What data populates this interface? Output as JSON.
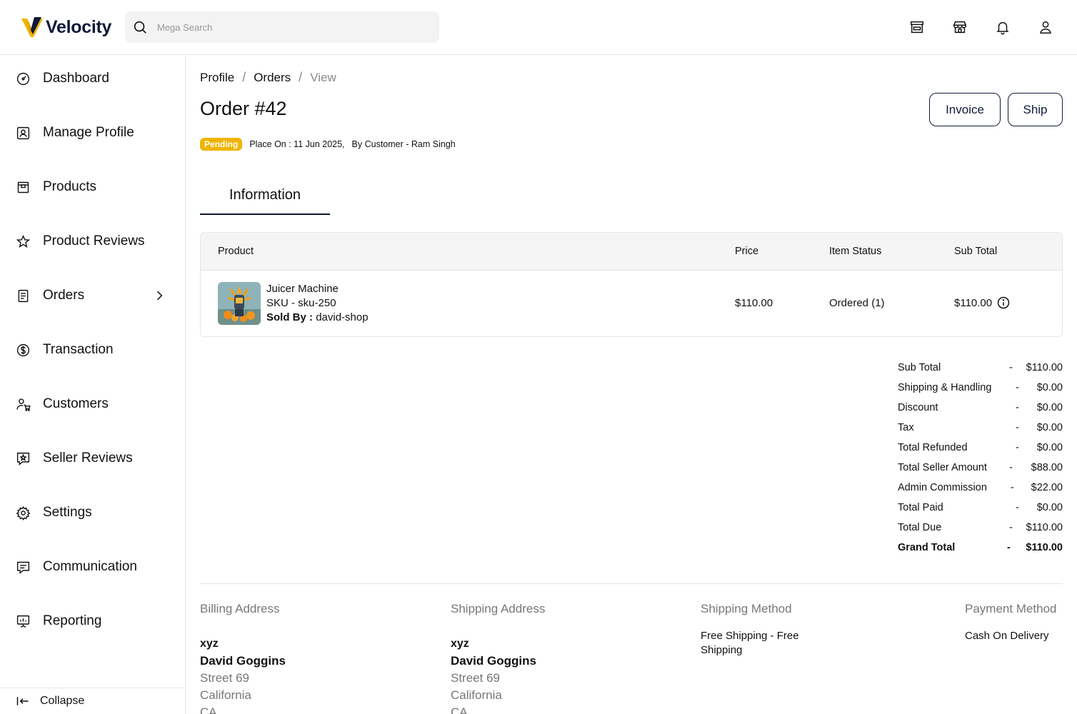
{
  "header": {
    "logo_text": "Velocity",
    "search_placeholder": "Mega Search",
    "icons": [
      "storefront-icon",
      "shop-icon",
      "bell-icon",
      "user-icon"
    ]
  },
  "sidebar": {
    "items": [
      {
        "label": "Dashboard",
        "icon": "dashboard-icon"
      },
      {
        "label": "Manage Profile",
        "icon": "profile-icon"
      },
      {
        "label": "Products",
        "icon": "products-icon"
      },
      {
        "label": "Product Reviews",
        "icon": "star-icon"
      },
      {
        "label": "Orders",
        "icon": "orders-icon"
      },
      {
        "label": "Transaction",
        "icon": "dollar-icon"
      },
      {
        "label": "Customers",
        "icon": "customers-icon"
      },
      {
        "label": "Seller Reviews",
        "icon": "seller-review-icon"
      },
      {
        "label": "Settings",
        "icon": "gear-icon"
      },
      {
        "label": "Communication",
        "icon": "chat-icon"
      },
      {
        "label": "Reporting",
        "icon": "report-icon"
      }
    ],
    "collapse_label": "Collapse"
  },
  "breadcrumb": {
    "items": [
      "Profile",
      "Orders"
    ],
    "current": "View"
  },
  "order": {
    "title": "Order #42",
    "status": "Pending",
    "placed": "Place On : 11 Jun 2025,",
    "customer": "By Customer - Ram Singh",
    "status_color": "#f0b400"
  },
  "actions": {
    "invoice": "Invoice",
    "ship": "Ship"
  },
  "tabs": {
    "information": "Information"
  },
  "table": {
    "headers": {
      "product": "Product",
      "price": "Price",
      "item_status": "Item Status",
      "sub_total": "Sub Total"
    },
    "rows": [
      {
        "name": "Juicer Machine",
        "sku": "SKU - sku-250",
        "sold_by_label": "Sold By :",
        "sold_by": "david-shop",
        "price": "$110.00",
        "status": "Ordered (1)",
        "sub_total": "$110.00"
      }
    ]
  },
  "totals": [
    {
      "label": "Sub Total",
      "value": "$110.00"
    },
    {
      "label": "Shipping & Handling",
      "value": "$0.00"
    },
    {
      "label": "Discount",
      "value": "$0.00"
    },
    {
      "label": "Tax",
      "value": "$0.00"
    },
    {
      "label": "Total Refunded",
      "value": "$0.00"
    },
    {
      "label": "Total Seller Amount",
      "value": "$88.00"
    },
    {
      "label": "Admin Commission",
      "value": "$22.00"
    },
    {
      "label": "Total Paid",
      "value": "$0.00"
    },
    {
      "label": "Total Due",
      "value": "$110.00"
    },
    {
      "label": "Grand Total",
      "value": "$110.00"
    }
  ],
  "totals_separator": "-",
  "billing": {
    "title": "Billing Address",
    "line1": "xyz",
    "name": "David Goggins",
    "street": "Street 69",
    "state": "California",
    "country": "CA"
  },
  "shipping": {
    "title": "Shipping Address",
    "line1": "xyz",
    "name": "David Goggins",
    "street": "Street 69",
    "state": "California",
    "country": "CA"
  },
  "shipping_method": {
    "title": "Shipping Method",
    "value": "Free Shipping - Free Shipping"
  },
  "payment_method": {
    "title": "Payment Method",
    "value": "Cash On Delivery"
  }
}
